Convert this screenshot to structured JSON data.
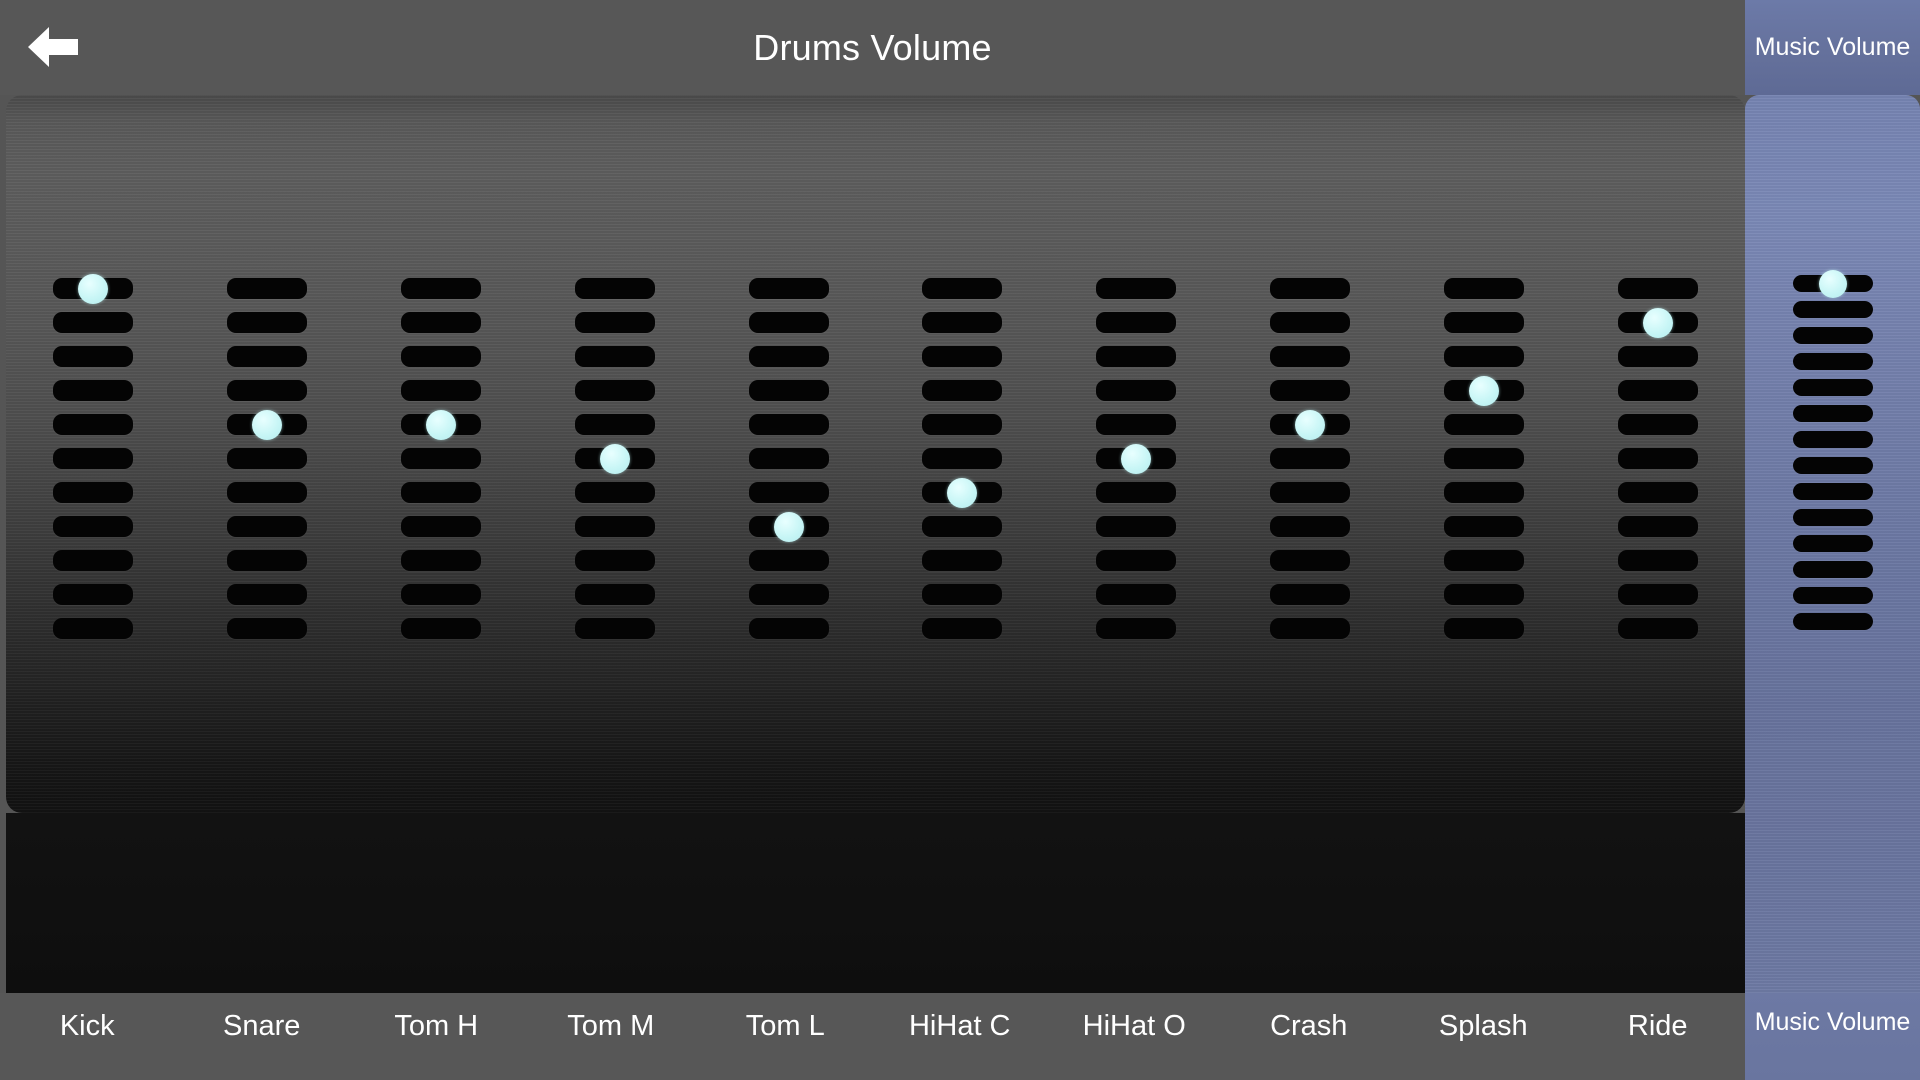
{
  "header": {
    "title": "Drums Volume",
    "back_icon": "back-arrow-icon"
  },
  "music": {
    "tab_label": "Music Volume",
    "footer_label": "Music Volume",
    "accent_color": "#6b77a2",
    "segments": 14,
    "knob_index": 0,
    "value_percent": 100
  },
  "slider_common": {
    "segments": 11,
    "knob_color": "#c8f6f6",
    "track_color": "#040404"
  },
  "sliders": [
    {
      "label": "Kick",
      "knob_index": 0,
      "value_percent": 100
    },
    {
      "label": "Snare",
      "knob_index": 4,
      "value_percent": 60
    },
    {
      "label": "Tom H",
      "knob_index": 4,
      "value_percent": 60
    },
    {
      "label": "Tom M",
      "knob_index": 5,
      "value_percent": 50
    },
    {
      "label": "Tom L",
      "knob_index": 7,
      "value_percent": 30
    },
    {
      "label": "HiHat C",
      "knob_index": 6,
      "value_percent": 40
    },
    {
      "label": "HiHat O",
      "knob_index": 5,
      "value_percent": 50
    },
    {
      "label": "Crash",
      "knob_index": 4,
      "value_percent": 60
    },
    {
      "label": "Splash",
      "knob_index": 3,
      "value_percent": 70
    },
    {
      "label": "Ride",
      "knob_index": 1,
      "value_percent": 90
    }
  ]
}
